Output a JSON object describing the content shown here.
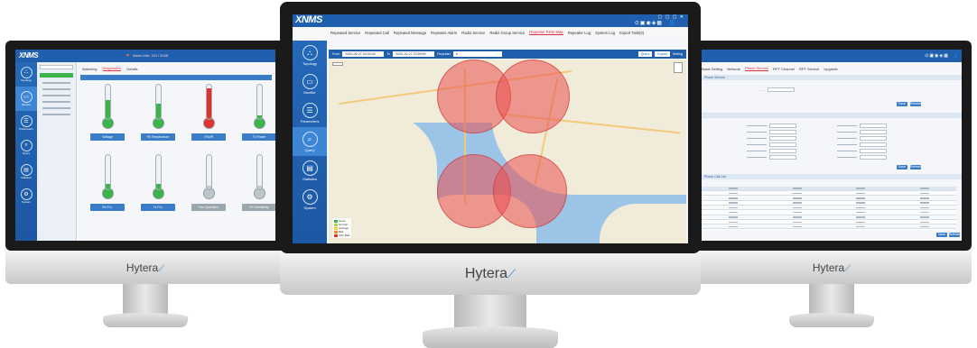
{
  "brand": "Hytera",
  "app_logo": "XNMS",
  "center_screen": {
    "tabs": [
      "Repeated Service",
      "Repeated Call",
      "Repeated Message",
      "Repeater Alarm",
      "Radio Service",
      "Radio Group Service",
      "Repeater RSSI Map",
      "Repeater Log",
      "System Log",
      "Export Task(0)"
    ],
    "active_tab": "Repeater RSSI Map",
    "nav": [
      {
        "label": "Topology",
        "icon": "topology-icon"
      },
      {
        "label": "Monitor",
        "icon": "monitor-icon"
      },
      {
        "label": "Parameters",
        "icon": "parameters-icon"
      },
      {
        "label": "Query",
        "icon": "query-icon"
      },
      {
        "label": "Statistics",
        "icon": "statistics-icon"
      },
      {
        "label": "System",
        "icon": "system-icon"
      }
    ],
    "active_nav": "Query",
    "filter": {
      "from_label": "From",
      "from_value": "2020-09-27 00:00:00",
      "to_label": "To",
      "to_value": "2020-10-27 23:59:59",
      "repeater_label": "Repeater",
      "query_label": "Query",
      "export_label": "Export",
      "setting_label": "Setting"
    },
    "legend": [
      "Good",
      "Normal",
      "Average",
      "Bad",
      "Very Bad"
    ],
    "legend_colors": [
      "#3bb54a",
      "#a5d64c",
      "#f5d23a",
      "#f08a2d",
      "#e0332f"
    ]
  },
  "left_screen": {
    "tabs": [
      "Watching",
      "Diagnostics",
      "Details"
    ],
    "active_tab": "Diagnostics",
    "alert_text": "Alarm Info: 110 / 2048",
    "gauges": [
      {
        "label": "Voltage",
        "fill": 0.55,
        "color": "#3bb54a"
      },
      {
        "label": "PA Temperature",
        "fill": 0.45,
        "color": "#3bb54a"
      },
      {
        "label": "VSWR",
        "fill": 0.9,
        "color": "#e0332f"
      },
      {
        "label": "Tx Power",
        "fill": 0.1,
        "color": "#3bb54a"
      },
      {
        "label": "Rx PLL",
        "fill": 0.15,
        "color": "#3bb54a"
      },
      {
        "label": "Tx PLL",
        "fill": 0.15,
        "color": "#3bb54a"
      },
      {
        "label": "Fan Operation",
        "fill": 0.1,
        "color": "#bfc7cc"
      },
      {
        "label": "Rx Sensitivity",
        "fill": 0.1,
        "color": "#bfc7cc"
      }
    ]
  },
  "right_screen": {
    "tabs": [
      "Basic Setting",
      "Network",
      "Phone Service",
      "RPT Channel",
      "RPT Service",
      "Upgrade"
    ],
    "active_tab": "Phone Service",
    "section1": "Phone Service",
    "section2": "Phone Call List",
    "save_label": "Save",
    "refresh_label": "Refresh"
  }
}
